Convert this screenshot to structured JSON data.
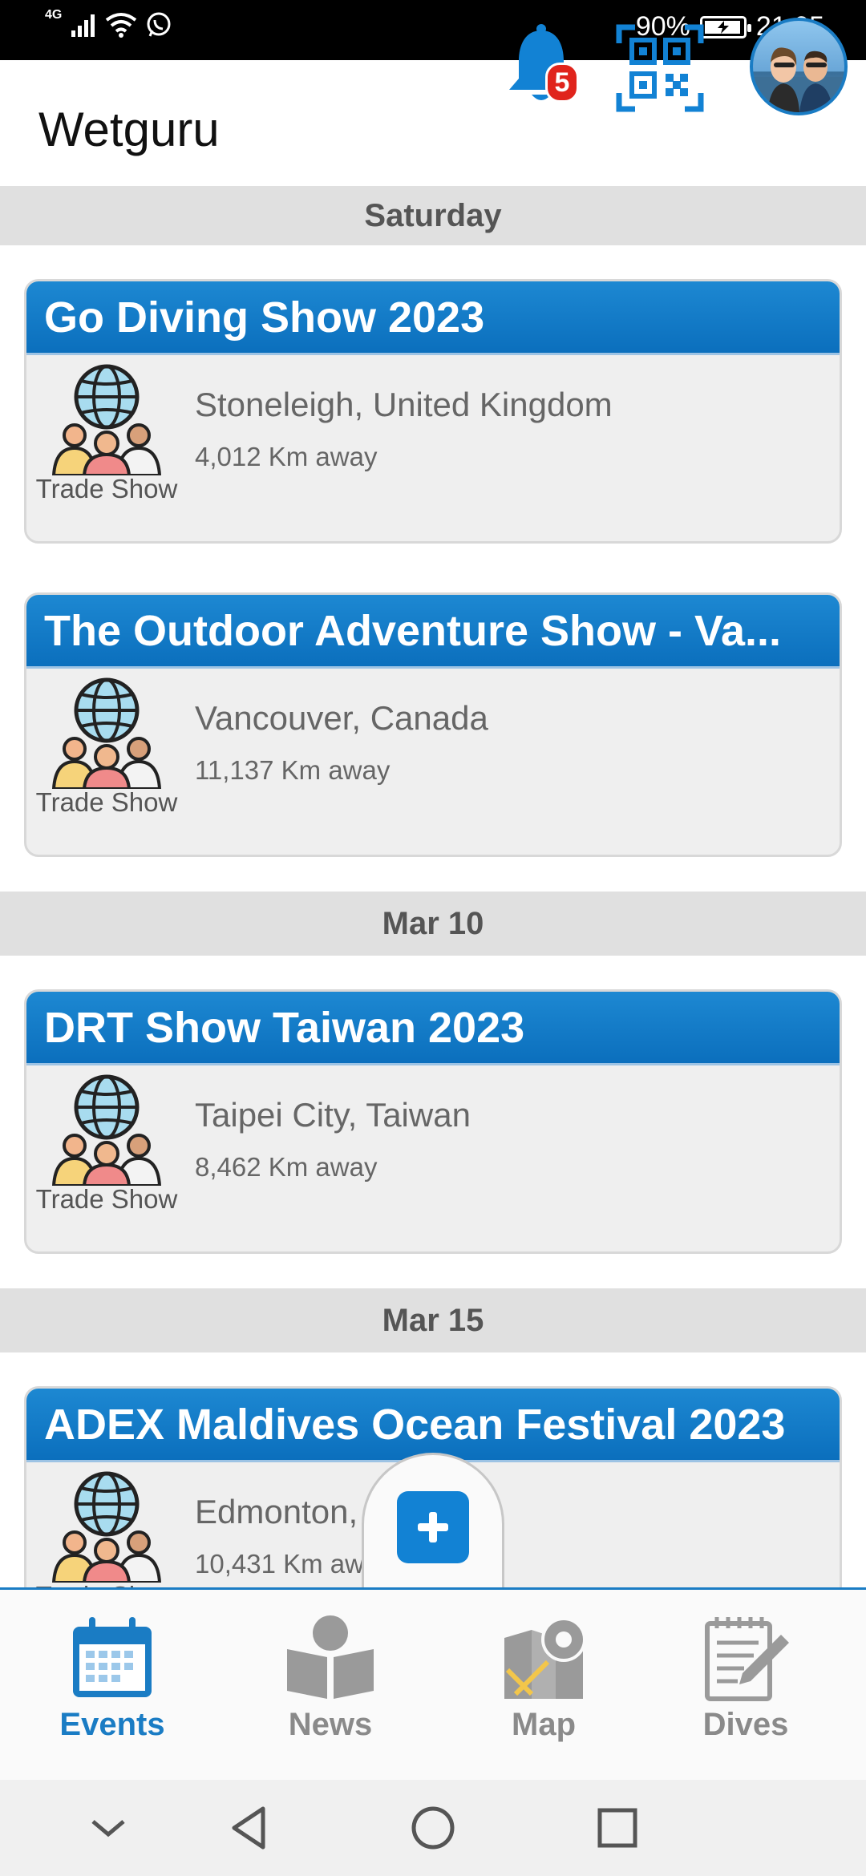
{
  "status_bar": {
    "network": "4G",
    "battery_percent": "90%",
    "battery_level": 0.9,
    "time": "21:05"
  },
  "app": {
    "title": "Wetguru",
    "notification_count": "5"
  },
  "sections": [
    {
      "date": "Saturday"
    },
    {
      "date": "Mar 10"
    },
    {
      "date": "Mar 15"
    }
  ],
  "events": [
    {
      "title": "Go Diving Show 2023",
      "location": "Stoneleigh, United Kingdom",
      "distance": "4,012 Km away",
      "type": "Trade Show"
    },
    {
      "title": "The Outdoor Adventure Show - Va...",
      "location": "Vancouver, Canada",
      "distance": "11,137 Km away",
      "type": "Trade Show"
    },
    {
      "title": "DRT Show Taiwan 2023",
      "location": "Taipei City, Taiwan",
      "distance": "8,462 Km away",
      "type": "Trade Show"
    },
    {
      "title": "ADEX Maldives Ocean Festival 2023",
      "location": "Edmonton,",
      "distance": "10,431 Km aw",
      "type": "Trade Show"
    }
  ],
  "bottom_nav": {
    "items": [
      {
        "label": "Events",
        "icon": "calendar-icon",
        "active": true
      },
      {
        "label": "News",
        "icon": "newspaper-reader-icon",
        "active": false
      },
      {
        "label": "Map",
        "icon": "map-pin-icon",
        "active": false
      },
      {
        "label": "Dives",
        "icon": "notepad-pencil-icon",
        "active": false
      }
    ]
  },
  "colors": {
    "primary": "#1a7cc4",
    "card_header": "#0b6fbd",
    "badge": "#e0241c",
    "section_bg": "#e0e0e0"
  }
}
